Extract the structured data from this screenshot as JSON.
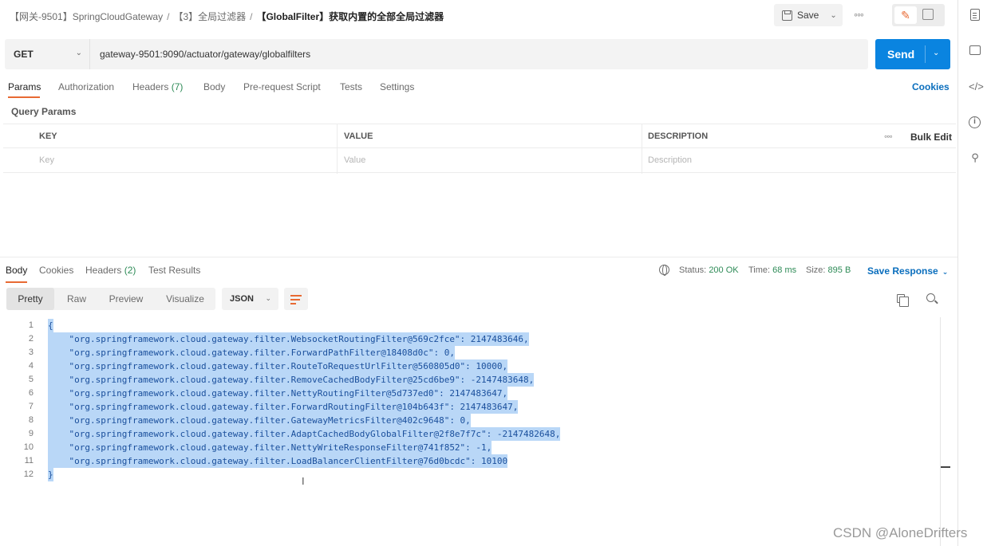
{
  "breadcrumb": {
    "item1": "【网关-9501】SpringCloudGateway",
    "item2": "【3】全局过滤器",
    "current": "【GlobalFilter】获取内置的全部全局过滤器",
    "separator": "/"
  },
  "toolbar": {
    "save_label": "Save",
    "more": "◦◦◦"
  },
  "request": {
    "method": "GET",
    "url": "gateway-9501:9090/actuator/gateway/globalfilters",
    "send_label": "Send"
  },
  "request_tabs": [
    {
      "label": "Params",
      "count": ""
    },
    {
      "label": "Authorization",
      "count": ""
    },
    {
      "label": "Headers",
      "count": "(7)"
    },
    {
      "label": "Body",
      "count": ""
    },
    {
      "label": "Pre-request Script",
      "count": ""
    },
    {
      "label": "Tests",
      "count": ""
    },
    {
      "label": "Settings",
      "count": ""
    }
  ],
  "cookies_link": "Cookies",
  "query_params": {
    "title": "Query Params",
    "headers": [
      "KEY",
      "VALUE",
      "DESCRIPTION"
    ],
    "placeholders": [
      "Key",
      "Value",
      "Description"
    ],
    "bulk_edit": "Bulk Edit",
    "more": "◦◦◦"
  },
  "response": {
    "tabs": [
      {
        "label": "Body",
        "count": ""
      },
      {
        "label": "Cookies",
        "count": ""
      },
      {
        "label": "Headers",
        "count": "(2)"
      },
      {
        "label": "Test Results",
        "count": ""
      }
    ],
    "status_label": "Status:",
    "status_value": "200 OK",
    "time_label": "Time:",
    "time_value": "68 ms",
    "size_label": "Size:",
    "size_value": "895 B",
    "save_response": "Save Response",
    "views": [
      "Pretty",
      "Raw",
      "Preview",
      "Visualize"
    ],
    "format": "JSON"
  },
  "code_lines": [
    "{",
    "    \"org.springframework.cloud.gateway.filter.WebsocketRoutingFilter@569c2fce\": 2147483646,",
    "    \"org.springframework.cloud.gateway.filter.ForwardPathFilter@18408d0c\": 0,",
    "    \"org.springframework.cloud.gateway.filter.RouteToRequestUrlFilter@560805d0\": 10000,",
    "    \"org.springframework.cloud.gateway.filter.RemoveCachedBodyFilter@25cd6be9\": -2147483648,",
    "    \"org.springframework.cloud.gateway.filter.NettyRoutingFilter@5d737ed0\": 2147483647,",
    "    \"org.springframework.cloud.gateway.filter.ForwardRoutingFilter@104b643f\": 2147483647,",
    "    \"org.springframework.cloud.gateway.filter.GatewayMetricsFilter@402c9648\": 0,",
    "    \"org.springframework.cloud.gateway.filter.AdaptCachedBodyGlobalFilter@2f8e7f7c\": -2147482648,",
    "    \"org.springframework.cloud.gateway.filter.NettyWriteResponseFilter@741f852\": -1,",
    "    \"org.springframework.cloud.gateway.filter.LoadBalancerClientFilter@76d0bcdc\": 10100",
    "}"
  ],
  "watermark": "CSDN @AloneDrifters",
  "colors": {
    "accent": "#e86a33",
    "send": "#0a84e0",
    "link": "#0a6ebd",
    "status_ok": "#2e8b57",
    "selection": "#b9d7f7"
  }
}
